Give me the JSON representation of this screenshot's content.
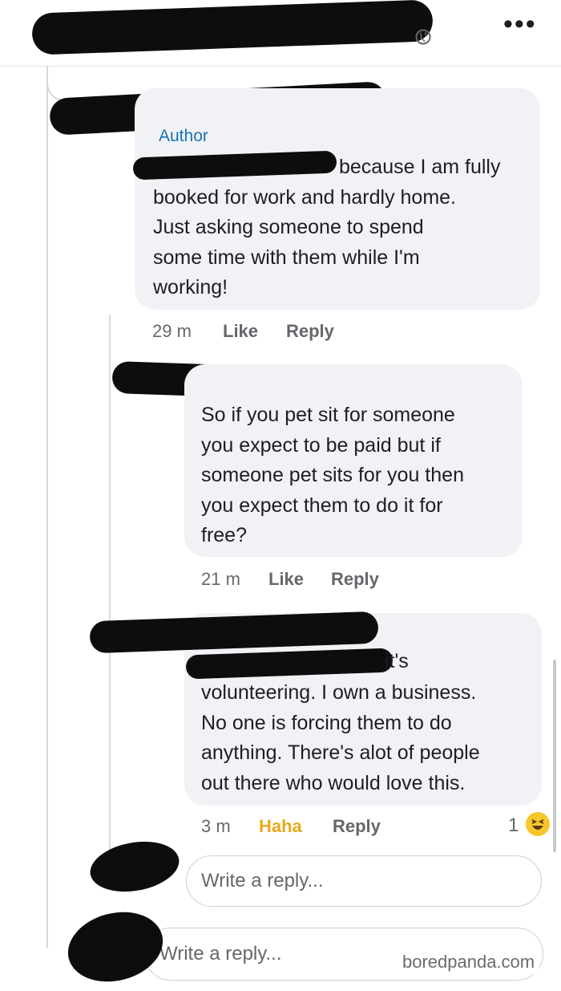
{
  "post": {
    "more_label": "•••"
  },
  "comments": [
    {
      "author_badge": "Author",
      "text": "because I am fully\nbooked for work and hardly home.\nJust asking someone to spend\nsome time with them while I'm\nworking!",
      "time": "29 m",
      "like_label": "Like",
      "reply_label": "Reply"
    },
    {
      "text": "So if you pet sit for someone\nyou expect to be paid but if\nsomeone pet sits for you then\nyou expect them to do it for\nfree?",
      "time": "21 m",
      "like_label": "Like",
      "reply_label": "Reply"
    },
    {
      "text_partial": "it's",
      "text": "volunteering. I own a business.\nNo one is forcing them to do\nanything. There's alot of people\nout there who would love this.",
      "time": "3 m",
      "reaction_label": "Haha",
      "reply_label": "Reply",
      "reaction_count": "1"
    }
  ],
  "reply_boxes": [
    {
      "placeholder": "Write a reply..."
    },
    {
      "placeholder": "Write a reply..."
    }
  ],
  "watermark": "boredpanda.com",
  "colors": {
    "author_link": "#1a74b8",
    "haha": "#e8a91b",
    "bubble": "#f0f2f5"
  }
}
